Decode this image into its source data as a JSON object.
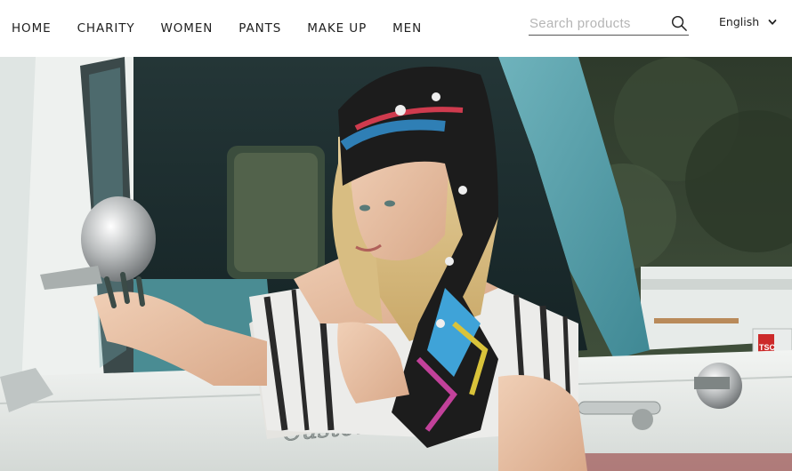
{
  "nav": {
    "items": [
      {
        "label": "HOME"
      },
      {
        "label": "CHARITY"
      },
      {
        "label": "WOMEN"
      },
      {
        "label": "PANTS"
      },
      {
        "label": "MAKE UP"
      },
      {
        "label": "MEN"
      }
    ]
  },
  "search": {
    "placeholder": "Search products",
    "value": "",
    "icon": "search-icon"
  },
  "language": {
    "selected": "English",
    "icon": "chevron-down-icon"
  },
  "hero": {
    "car_script": "Custom C",
    "sticker_text": "TSC"
  },
  "colors": {
    "truck_teal": "#5fa3ad",
    "truck_white": "#e9ecea",
    "background_foliage": "#33402f"
  }
}
